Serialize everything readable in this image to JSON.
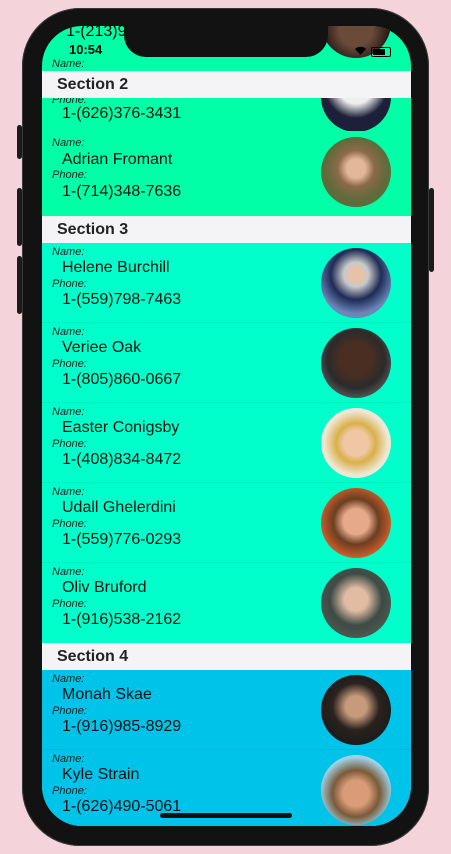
{
  "status": {
    "time": "10:54",
    "partial_top_phone": "1-(213)9"
  },
  "labels": {
    "name": "Name:",
    "phone": "Phone:"
  },
  "sections": [
    {
      "title": "Section 2",
      "color": "#00ffa7",
      "rows": [
        {
          "name": "",
          "phone": "1-(626)376-3431"
        },
        {
          "name": "Adrian Fromant",
          "phone": "1-(714)348-7636"
        }
      ]
    },
    {
      "title": "Section 3",
      "color": "#00ffcb",
      "rows": [
        {
          "name": "Helene Burchill",
          "phone": "1-(559)798-7463"
        },
        {
          "name": "Veriee Oak",
          "phone": "1-(805)860-0667"
        },
        {
          "name": "Easter Conigsby",
          "phone": "1-(408)834-8472"
        },
        {
          "name": "Udall Ghelerdini",
          "phone": "1-(559)776-0293"
        },
        {
          "name": "Oliv Bruford",
          "phone": "1-(916)538-2162"
        }
      ]
    },
    {
      "title": "Section 4",
      "color": "#00c3ea",
      "rows": [
        {
          "name": "Monah Skae",
          "phone": "1-(916)985-8929"
        },
        {
          "name": "Kyle Strain",
          "phone": "1-(626)490-5061"
        }
      ]
    }
  ]
}
